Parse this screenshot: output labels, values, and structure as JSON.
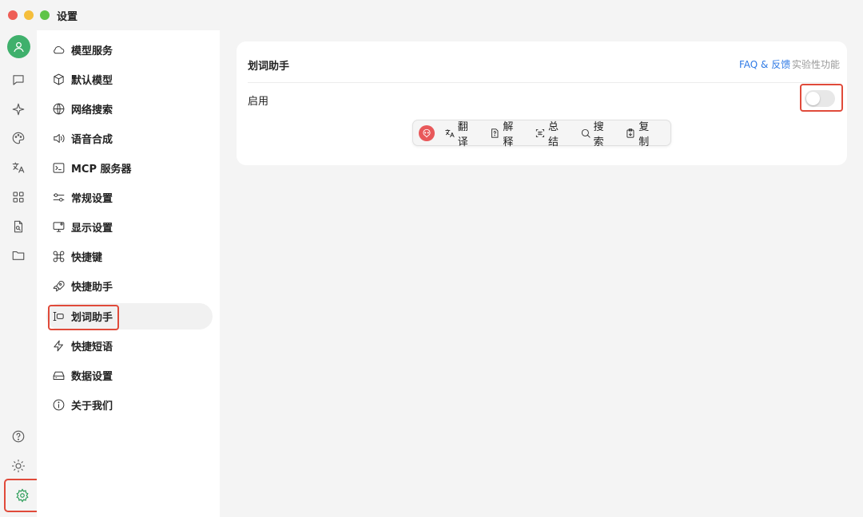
{
  "window": {
    "title": "设置"
  },
  "rail": {
    "items": [
      {
        "name": "chat-icon"
      },
      {
        "name": "sparkle-icon"
      },
      {
        "name": "palette-icon"
      },
      {
        "name": "translate-icon"
      },
      {
        "name": "apps-grid-icon"
      },
      {
        "name": "file-search-icon"
      },
      {
        "name": "folder-icon"
      }
    ],
    "bottom": [
      {
        "name": "help-icon"
      },
      {
        "name": "theme-toggle-icon"
      },
      {
        "name": "settings-icon"
      }
    ]
  },
  "sidebar": {
    "items": [
      {
        "label": "模型服务",
        "icon": "cloud-icon"
      },
      {
        "label": "默认模型",
        "icon": "cube-icon"
      },
      {
        "label": "网络搜索",
        "icon": "globe-icon"
      },
      {
        "label": "语音合成",
        "icon": "speaker-icon"
      },
      {
        "label": "MCP 服务器",
        "icon": "terminal-icon"
      },
      {
        "label": "常规设置",
        "icon": "sliders-icon"
      },
      {
        "label": "显示设置",
        "icon": "monitor-icon"
      },
      {
        "label": "快捷键",
        "icon": "command-icon"
      },
      {
        "label": "快捷助手",
        "icon": "rocket-icon"
      },
      {
        "label": "划词助手",
        "icon": "text-cursor-icon",
        "active": true
      },
      {
        "label": "快捷短语",
        "icon": "zap-icon"
      },
      {
        "label": "数据设置",
        "icon": "hard-drive-icon"
      },
      {
        "label": "关于我们",
        "icon": "info-icon"
      }
    ]
  },
  "main": {
    "title": "划词助手",
    "faq_link": "FAQ & 反馈",
    "beta_label": "实验性功能",
    "enable_label": "启用",
    "enabled": false,
    "toolbar": [
      {
        "label": "翻译",
        "icon": "translate-icon"
      },
      {
        "label": "解释",
        "icon": "question-doc-icon"
      },
      {
        "label": "总结",
        "icon": "summary-icon"
      },
      {
        "label": "搜索",
        "icon": "search-icon"
      },
      {
        "label": "复制",
        "icon": "copy-icon"
      }
    ]
  },
  "colors": {
    "accent_green": "#3fb06c",
    "link_blue": "#2f7ae5",
    "highlight_red": "#e04a3a",
    "logo_red": "#e8585a"
  }
}
